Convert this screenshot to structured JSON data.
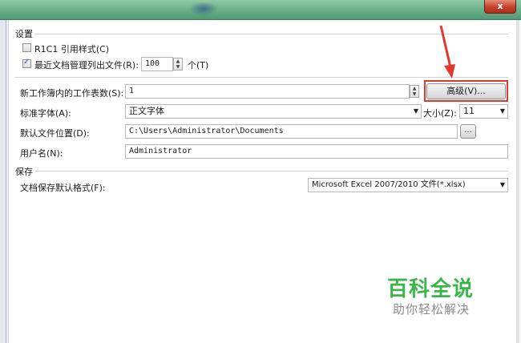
{
  "window": {
    "close_label": "x"
  },
  "settings": {
    "group_title": "设置",
    "r1c1_label": "R1C1 引用样式(C)",
    "r1c1_checked": false,
    "recent_label": "最近文档管理列出文件(R):",
    "recent_checked": true,
    "recent_value": "100",
    "recent_unit": "个(T)",
    "sheets_label": "新工作簿内的工作表数(S):",
    "sheets_value": "1",
    "advanced_button": "高级(V)...",
    "font_label": "标准字体(A):",
    "font_value": "正文字体",
    "size_label": "大小(Z):",
    "size_value": "11",
    "location_label": "默认文件位置(D):",
    "location_value": "C:\\Users\\Administrator\\Documents",
    "browse_button": "...",
    "username_label": "用户名(N):",
    "username_value": "Administrator"
  },
  "save": {
    "group_title": "保存",
    "format_label": "文档保存默认格式(F):",
    "format_value": "Microsoft Excel 2007/2010 文件(*.xlsx)"
  },
  "watermark": {
    "main": "百科全说",
    "sub": "助你轻松解决"
  },
  "colors": {
    "highlight": "#e03a2e",
    "watermark": "#3bb54a"
  }
}
